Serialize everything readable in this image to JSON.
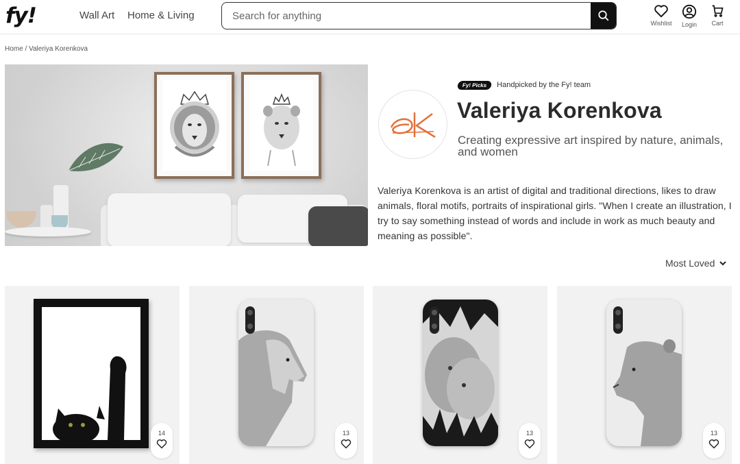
{
  "header": {
    "logo": "fy!",
    "nav": [
      "Wall Art",
      "Home & Living"
    ],
    "search_placeholder": "Search for anything",
    "icons": [
      {
        "label": "Wishlist",
        "icon": "heart-icon"
      },
      {
        "label": "Login",
        "icon": "user-icon"
      },
      {
        "label": "Cart",
        "icon": "cart-icon"
      }
    ]
  },
  "breadcrumb": {
    "home": "Home",
    "separator": " / ",
    "current": "Valeriya Korenkova"
  },
  "artist": {
    "picks_badge": "Fy! Picks",
    "picks_text": "Handpicked by the Fy! team",
    "name": "Valeriya Korenkova",
    "tagline": "Creating expressive art inspired by nature, animals, and women",
    "bio": "Valeriya Korenkova is an artist of digital and traditional directions, likes to draw animals, floral motifs, portraits of inspirational girls. \"When I create an illustration, I try to say something instead of words and include in work as much beauty and meaning as possible\"."
  },
  "sort": {
    "label": "Most Loved"
  },
  "products": [
    {
      "likes": "14"
    },
    {
      "likes": "13"
    },
    {
      "likes": "13"
    },
    {
      "likes": "13"
    }
  ],
  "colors": {
    "accent": "#111111",
    "logo_orange": "#e2703a"
  }
}
